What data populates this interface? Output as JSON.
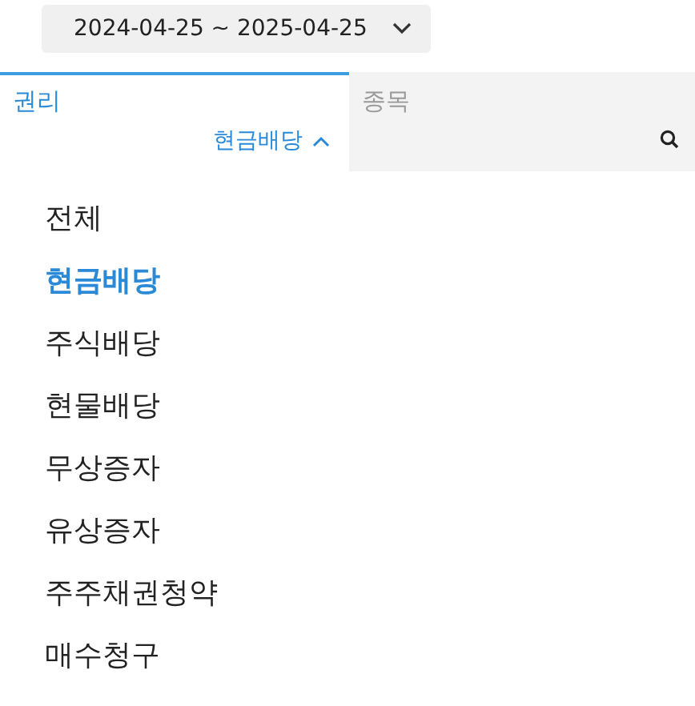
{
  "date_range": {
    "label": "2024-04-25 ~ 2025-04-25"
  },
  "tabs": [
    {
      "label": "권리",
      "selected": true
    },
    {
      "label": "종목",
      "selected": false
    }
  ],
  "filter": {
    "value": "현금배당",
    "expanded": true
  },
  "options": [
    {
      "label": "전체",
      "selected": false
    },
    {
      "label": "현금배당",
      "selected": true
    },
    {
      "label": "주식배당",
      "selected": false
    },
    {
      "label": "현물배당",
      "selected": false
    },
    {
      "label": "무상증자",
      "selected": false
    },
    {
      "label": "유상증자",
      "selected": false
    },
    {
      "label": "주주채권청약",
      "selected": false
    },
    {
      "label": "매수청구",
      "selected": false
    }
  ]
}
